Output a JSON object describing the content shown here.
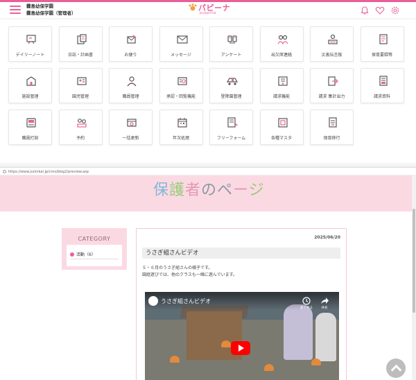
{
  "header": {
    "org_line1": "霧島幼保学園",
    "org_line2": "霧島幼保学園（管理者）",
    "logo_text": "パピーナ",
    "logo_sub": "puppina"
  },
  "menu": [
    {
      "label": "デイリーノート",
      "icon": "whiteboard-icon"
    },
    {
      "label": "日誌・計画書",
      "icon": "journal-icon"
    },
    {
      "label": "お便り",
      "icon": "letter-edit-icon"
    },
    {
      "label": "メッセージ",
      "icon": "envelope-icon"
    },
    {
      "label": "アンケート",
      "icon": "survey-icon"
    },
    {
      "label": "出欠席連絡",
      "icon": "attendance-icon"
    },
    {
      "label": "災害伝言板",
      "icon": "disaster-board-icon"
    },
    {
      "label": "保育要録等",
      "icon": "records-icon"
    },
    {
      "label": "施設管理",
      "icon": "building-icon"
    },
    {
      "label": "園児管理",
      "icon": "children-icon"
    },
    {
      "label": "職員管理",
      "icon": "staff-icon"
    },
    {
      "label": "承認・回覧機能",
      "icon": "approval-icon"
    },
    {
      "label": "登降園管理",
      "icon": "pickup-icon"
    },
    {
      "label": "請求機能",
      "icon": "invoice-icon"
    },
    {
      "label": "請求 集計出力",
      "icon": "invoice-export-icon"
    },
    {
      "label": "請求資料",
      "icon": "invoice-docs-icon"
    },
    {
      "label": "職員打刻",
      "icon": "time-clock-icon"
    },
    {
      "label": "予約",
      "icon": "reservation-icon"
    },
    {
      "label": "一括更新",
      "icon": "bulk-update-icon"
    },
    {
      "label": "年次処理",
      "icon": "calendar-icon"
    },
    {
      "label": "フリーフォーム",
      "icon": "free-form-icon"
    },
    {
      "label": "各種マスタ",
      "icon": "master-icon"
    },
    {
      "label": "保育移行",
      "icon": "migration-icon"
    }
  ],
  "status_url": "https://www.juninkai.jp/cms/blog2/preview.asp",
  "parent_page": {
    "banner_title_parts": [
      "保",
      "護",
      "者",
      "のペ",
      "ー",
      "ジ"
    ],
    "category_heading": "CATEGORY",
    "category_item": "活動（6）",
    "post": {
      "date": "2025/06/20",
      "title": "うさぎ組さんビデオ",
      "body_line1": "５・６月のうさぎ組さんの様子です。",
      "body_line2": "園庭遊びでは、他のクラスも一緒に遊んでいます。",
      "video_title": "うさぎ組さんビデオ",
      "video_watch_later": "後で見る",
      "video_share": "共有"
    }
  },
  "colors": {
    "accent": "#e8609a",
    "banner_bg": "#fbd9e3"
  }
}
